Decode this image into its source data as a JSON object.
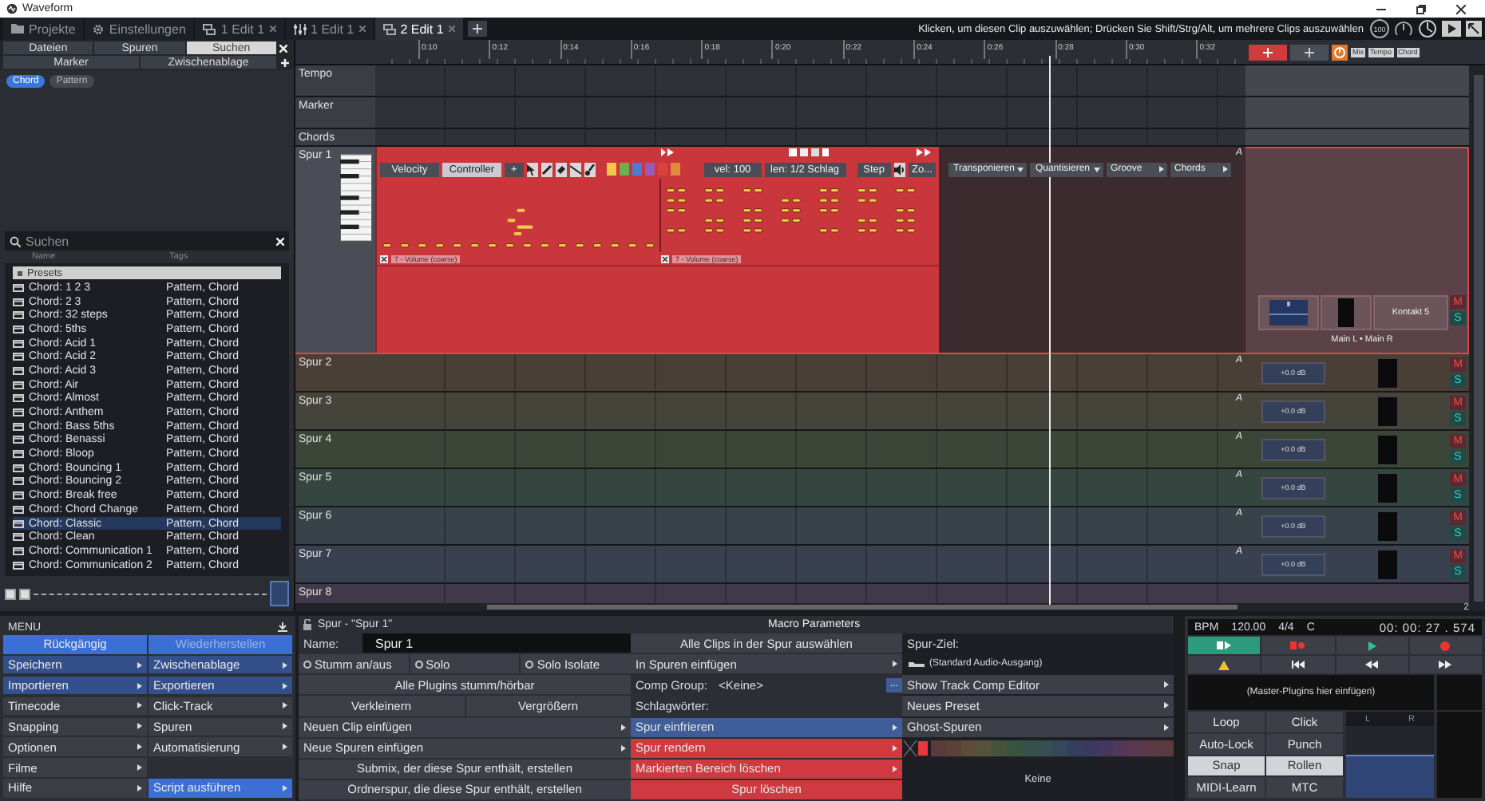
{
  "window": {
    "title": "Waveform"
  },
  "tabs": [
    {
      "label": "Projekte",
      "kind": "folder",
      "selected": false,
      "closable": false
    },
    {
      "label": "Einstellungen",
      "kind": "gear",
      "selected": false,
      "closable": false
    },
    {
      "label": "1 Edit 1",
      "kind": "edit",
      "selected": false,
      "closable": true
    },
    {
      "label": "1 Edit 1",
      "kind": "mixer",
      "selected": false,
      "closable": true
    },
    {
      "label": "2 Edit 1",
      "kind": "edit",
      "selected": true,
      "closable": true
    }
  ],
  "hint": "Klicken, um diesen Clip auszuwählen; Drücken Sie Shift/Strg/Alt, um mehrere Clips auszuwählen",
  "cpu": "100",
  "browser": {
    "tabs": [
      {
        "label": "Dateien",
        "selected": false
      },
      {
        "label": "Spuren",
        "selected": false
      },
      {
        "label": "Suchen",
        "selected": true
      }
    ],
    "tabs_row2": [
      {
        "label": "Marker",
        "selected": false
      },
      {
        "label": "Zwischenablage",
        "selected": false
      }
    ],
    "filters": [
      {
        "label": "Chord",
        "selected": true
      },
      {
        "label": "Pattern",
        "selected": false
      }
    ],
    "search": {
      "placeholder": "Suchen"
    },
    "columns": [
      "Name",
      "Tags"
    ],
    "group": "Presets",
    "items": [
      {
        "name": "Chord: 1 2 3",
        "tags": "Pattern, Chord",
        "selected": false
      },
      {
        "name": "Chord: 2 3",
        "tags": "Pattern, Chord",
        "selected": false
      },
      {
        "name": "Chord: 32 steps",
        "tags": "Pattern, Chord",
        "selected": false
      },
      {
        "name": "Chord: 5ths",
        "tags": "Pattern, Chord",
        "selected": false
      },
      {
        "name": "Chord: Acid 1",
        "tags": "Pattern, Chord",
        "selected": false
      },
      {
        "name": "Chord: Acid 2",
        "tags": "Pattern, Chord",
        "selected": false
      },
      {
        "name": "Chord: Acid 3",
        "tags": "Pattern, Chord",
        "selected": false
      },
      {
        "name": "Chord: Air",
        "tags": "Pattern, Chord",
        "selected": false
      },
      {
        "name": "Chord: Almost",
        "tags": "Pattern, Chord",
        "selected": false
      },
      {
        "name": "Chord: Anthem",
        "tags": "Pattern, Chord",
        "selected": false
      },
      {
        "name": "Chord: Bass 5ths",
        "tags": "Pattern, Chord",
        "selected": false
      },
      {
        "name": "Chord: Benassi",
        "tags": "Pattern, Chord",
        "selected": false
      },
      {
        "name": "Chord: Bloop",
        "tags": "Pattern, Chord",
        "selected": false
      },
      {
        "name": "Chord: Bouncing 1",
        "tags": "Pattern, Chord",
        "selected": false
      },
      {
        "name": "Chord: Bouncing 2",
        "tags": "Pattern, Chord",
        "selected": false
      },
      {
        "name": "Chord: Break free",
        "tags": "Pattern, Chord",
        "selected": false
      },
      {
        "name": "Chord: Chord Change",
        "tags": "Pattern, Chord",
        "selected": false
      },
      {
        "name": "Chord: Classic",
        "tags": "Pattern, Chord",
        "selected": true
      },
      {
        "name": "Chord: Clean",
        "tags": "Pattern, Chord",
        "selected": false
      },
      {
        "name": "Chord: Communication 1",
        "tags": "Pattern, Chord",
        "selected": false
      },
      {
        "name": "Chord: Communication 2",
        "tags": "Pattern, Chord",
        "selected": false
      }
    ]
  },
  "ruler": {
    "labels": [
      "0:10",
      "0:12",
      "0:14",
      "0:16",
      "0:18",
      "0:20",
      "0:22",
      "0:24",
      "0:26",
      "0:28",
      "0:30",
      "0:32"
    ]
  },
  "view_buttons": [
    "Mix",
    "Tempo",
    "Chord"
  ],
  "tracks": [
    {
      "name": "Tempo",
      "kind": "global"
    },
    {
      "name": "Marker",
      "kind": "global"
    },
    {
      "name": "Chords",
      "kind": "chords"
    },
    {
      "name": "Spur 1",
      "kind": "midi",
      "selected": true,
      "automation": "A",
      "mute": "M",
      "solo": "S",
      "plugin": "Kontakt 5",
      "routing": "Main L • Main R"
    },
    {
      "name": "Spur 2",
      "kind": "audio",
      "selected": false,
      "color": "#4a3f37",
      "automation": "A",
      "volume": "+0.0 dB",
      "mute": "M",
      "solo": "S"
    },
    {
      "name": "Spur 3",
      "kind": "audio",
      "selected": false,
      "color": "#45443a",
      "automation": "A",
      "volume": "+0.0 dB",
      "mute": "M",
      "solo": "S"
    },
    {
      "name": "Spur 4",
      "kind": "audio",
      "selected": false,
      "color": "#3b4639",
      "automation": "A",
      "volume": "+0.0 dB",
      "mute": "M",
      "solo": "S"
    },
    {
      "name": "Spur 5",
      "kind": "audio",
      "selected": false,
      "color": "#34463f",
      "automation": "A",
      "volume": "+0.0 dB",
      "mute": "M",
      "solo": "S"
    },
    {
      "name": "Spur 6",
      "kind": "audio",
      "selected": false,
      "color": "#374249",
      "automation": "A",
      "volume": "+0.0 dB",
      "mute": "M",
      "solo": "S"
    },
    {
      "name": "Spur 7",
      "kind": "audio",
      "selected": false,
      "color": "#39404f",
      "automation": "A",
      "volume": "+0.0 dB",
      "mute": "M",
      "solo": "S"
    },
    {
      "name": "Spur 8",
      "kind": "audio",
      "selected": false,
      "color": "#40394a"
    }
  ],
  "clip": {
    "tabs": [
      {
        "label": "Velocity",
        "selected": false
      },
      {
        "label": "Controller",
        "selected": true
      }
    ],
    "add": "+",
    "velocity": "vel: 100",
    "length": "len: 1/2 Schlag",
    "step": "Step",
    "zoom": "Zo...",
    "lanes": [
      "7 - Volume (coarse)",
      "7 - Volume (coarse)"
    ],
    "menus": [
      {
        "label": "Transponieren",
        "kind": "dropdown"
      },
      {
        "label": "Quantisieren",
        "kind": "dropdown"
      },
      {
        "label": "Groove",
        "kind": "submenu"
      },
      {
        "label": "Chords",
        "kind": "submenu"
      }
    ]
  },
  "page_label": "2",
  "menu": {
    "title": "MENU",
    "items": [
      {
        "label": "Rückgängig",
        "kind": "primary",
        "submenu": false,
        "disabled": false
      },
      {
        "label": "Wiederherstellen",
        "kind": "primary",
        "submenu": false,
        "disabled": true
      },
      {
        "label": "Speichern",
        "kind": "highlighted",
        "submenu": true,
        "disabled": false
      },
      {
        "label": "Zwischenablage",
        "kind": "highlighted",
        "submenu": true,
        "disabled": false
      },
      {
        "label": "Importieren",
        "kind": "highlighted",
        "submenu": true,
        "disabled": false
      },
      {
        "label": "Exportieren",
        "kind": "highlighted",
        "submenu": true,
        "disabled": false
      },
      {
        "label": "Timecode",
        "kind": "plain",
        "submenu": true,
        "disabled": false
      },
      {
        "label": "Click-Track",
        "kind": "plain",
        "submenu": true,
        "disabled": false
      },
      {
        "label": "Snapping",
        "kind": "plain",
        "submenu": true,
        "disabled": false
      },
      {
        "label": "Spuren",
        "kind": "plain",
        "submenu": true,
        "disabled": false
      },
      {
        "label": "Optionen",
        "kind": "plain",
        "submenu": true,
        "disabled": false
      },
      {
        "label": "Automatisierung",
        "kind": "plain",
        "submenu": true,
        "disabled": false
      },
      {
        "label": "Filme",
        "kind": "plain",
        "submenu": true,
        "disabled": false
      },
      {
        "kind": "gap"
      },
      {
        "label": "Hilfe",
        "kind": "plain",
        "submenu": true,
        "disabled": false
      },
      {
        "label": "Script ausführen",
        "kind": "primary",
        "submenu": true,
        "disabled": false
      }
    ]
  },
  "track_panel": {
    "title": "Spur - \"Spur 1\"",
    "macro_tab": "Macro Parameters",
    "left": [
      {
        "kind": "name",
        "label": "Name:",
        "value": "Spur 1"
      },
      {
        "kind": "radios",
        "options": [
          {
            "label": "Stumm an/aus",
            "checked": false
          },
          {
            "label": "Solo",
            "checked": false
          },
          {
            "label": "Solo Isolate",
            "checked": false
          }
        ]
      },
      {
        "kind": "button",
        "label": "Alle Plugins stumm/hörbar"
      },
      {
        "kind": "pair",
        "labels": [
          "Verkleinern",
          "Vergrößern"
        ]
      },
      {
        "kind": "submenu",
        "label": "Neuen Clip einfügen"
      },
      {
        "kind": "submenu",
        "label": "Neue Spuren einfügen"
      },
      {
        "kind": "button",
        "label": "Submix, der diese Spur enthält, erstellen"
      },
      {
        "kind": "button",
        "label": "Ordnerspur, die diese Spur enthält, erstellen"
      }
    ],
    "middle": [
      {
        "kind": "button",
        "label": "Alle Clips in der Spur auswählen"
      },
      {
        "kind": "submenu",
        "label": "In Spuren einfügen"
      },
      {
        "kind": "field",
        "label": "Comp Group:",
        "value": "<Keine>",
        "action": "..."
      },
      {
        "kind": "label",
        "label": "Schlagwörter:"
      },
      {
        "kind": "submenu",
        "label": "Spur einfrieren",
        "color": "#3f5d99"
      },
      {
        "kind": "submenu",
        "label": "Spur rendern",
        "color": "#d0393f"
      },
      {
        "kind": "submenu",
        "label": "Markierten Bereich löschen",
        "color": "#d0393f"
      },
      {
        "kind": "button",
        "label": "Spur löschen",
        "color": "#d0393f"
      }
    ],
    "right": [
      {
        "kind": "label",
        "label": "Spur-Ziel:"
      },
      {
        "kind": "output",
        "label": "(Standard Audio-Ausgang)"
      },
      {
        "kind": "submenu",
        "label": "Show Track Comp Editor"
      },
      {
        "kind": "submenu",
        "label": "Neues Preset"
      },
      {
        "kind": "submenu",
        "label": "Ghost-Spuren"
      },
      {
        "kind": "palette"
      },
      {
        "kind": "caption",
        "label": "Keine"
      }
    ]
  },
  "transport": {
    "bpm_label": "BPM",
    "bpm": "120.00",
    "signature": "4/4",
    "key": "C",
    "time": "00: 00: 27 . 574",
    "master": "(Master-Plugins hier einfügen)",
    "toggles": [
      {
        "label": "Loop",
        "on": false
      },
      {
        "label": "Click",
        "on": false
      },
      {
        "label": "Auto-Lock",
        "on": false
      },
      {
        "label": "Punch",
        "on": false
      },
      {
        "label": "Snap",
        "on": true
      },
      {
        "label": "Rollen",
        "on": true
      },
      {
        "label": "MIDI-Learn",
        "on": false
      },
      {
        "label": "MTC",
        "on": false
      }
    ],
    "meter": [
      "L",
      "R"
    ]
  }
}
